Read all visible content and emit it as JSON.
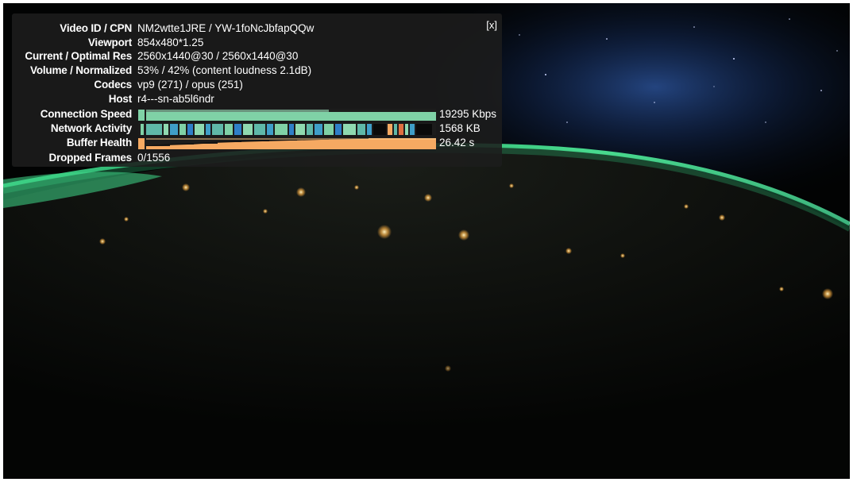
{
  "stats": {
    "close_label": "[x]",
    "rows": [
      {
        "label": "Video ID / CPN",
        "value": "NM2wtte1JRE / YW-1foNcJbfapQQw"
      },
      {
        "label": "Viewport",
        "value": "854x480*1.25"
      },
      {
        "label": "Current / Optimal Res",
        "value": "2560x1440@30 / 2560x1440@30"
      },
      {
        "label": "Volume / Normalized",
        "value": "53% / 42% (content loudness 2.1dB)"
      },
      {
        "label": "Codecs",
        "value": "vp9 (271) / opus (251)"
      },
      {
        "label": "Host",
        "value": "r4---sn-ab5l6ndr"
      }
    ],
    "connection_speed": {
      "label": "Connection Speed",
      "value": "19295 Kbps"
    },
    "network_activity": {
      "label": "Network Activity",
      "value": "1568 KB"
    },
    "buffer_health": {
      "label": "Buffer Health",
      "value": "26.42 s"
    },
    "dropped_frames": {
      "label": "Dropped Frames",
      "value": "0/1556"
    }
  },
  "colors": {
    "panel_bg": "#1c1c1c",
    "connection_graph": "#7fd1a6",
    "network_graph": "#5fb8a8",
    "buffer_graph": "#f5a962",
    "aurora": "#3fd98a"
  }
}
